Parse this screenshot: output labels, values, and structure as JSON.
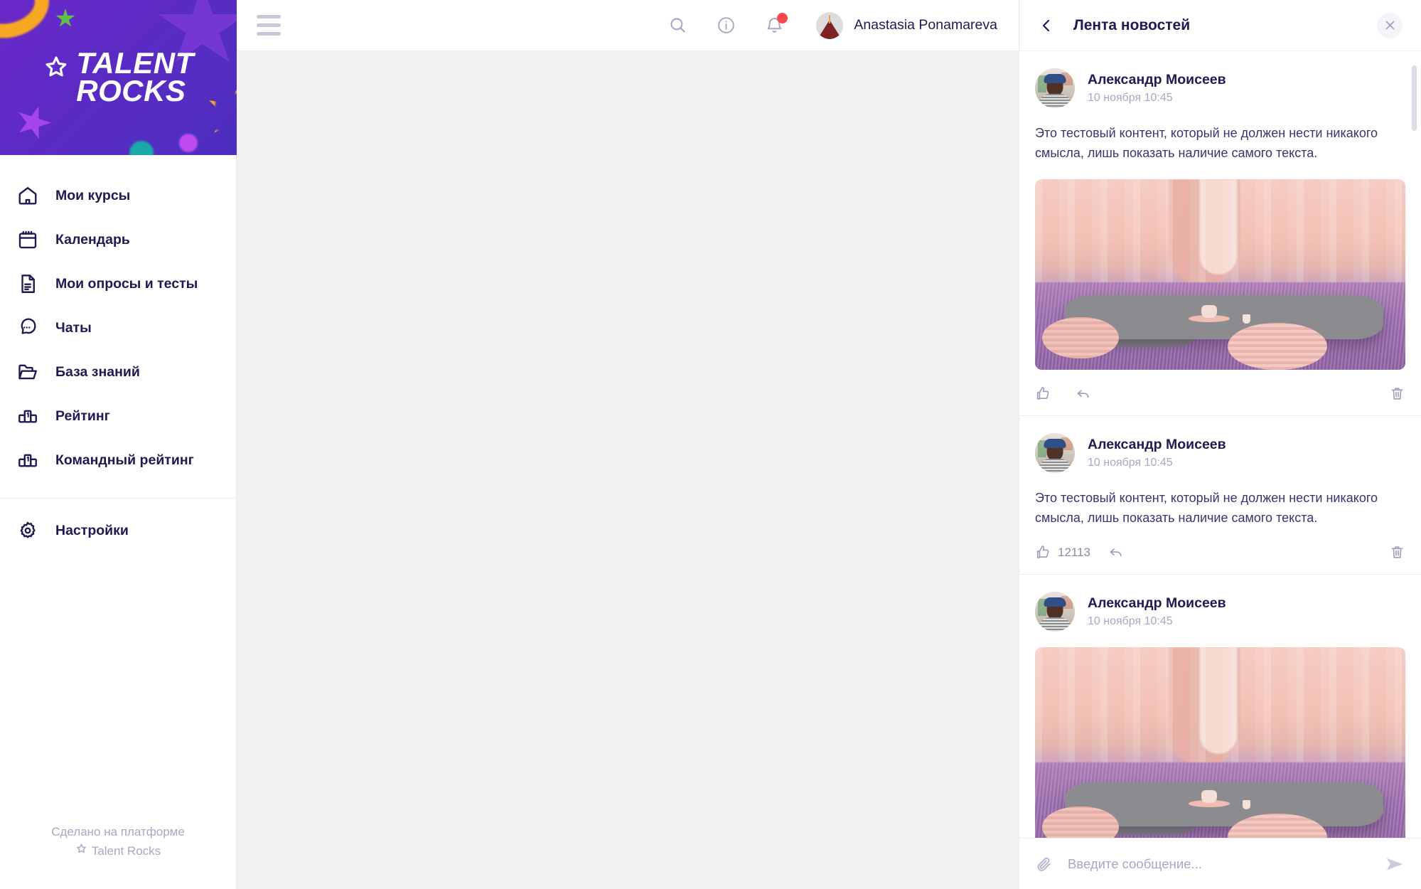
{
  "brand": {
    "line1": "TALENT",
    "line2": "ROCKS",
    "star_icon": "star-icon"
  },
  "sidebar": {
    "items": [
      {
        "label": "Мои курсы",
        "icon": "home-icon"
      },
      {
        "label": "Календарь",
        "icon": "calendar-icon"
      },
      {
        "label": "Мои опросы и тесты",
        "icon": "document-icon"
      },
      {
        "label": "Чаты",
        "icon": "chat-bubble-icon"
      },
      {
        "label": "База знаний",
        "icon": "folder-icon"
      },
      {
        "label": "Рейтинг",
        "icon": "podium-icon"
      },
      {
        "label": "Командный рейтинг",
        "icon": "podium-icon"
      }
    ],
    "settings": {
      "label": "Настройки",
      "icon": "gear-icon"
    },
    "footer": {
      "line1": "Сделано на платформе",
      "line2": "Talent Rocks",
      "star_icon": "star-icon"
    }
  },
  "topbar": {
    "menu_icon": "hamburger-icon",
    "search_icon": "search-icon",
    "info_icon": "info-icon",
    "bell_icon": "bell-icon",
    "has_notification": true,
    "user_name": "Anastasia Ponamareva",
    "avatar_icon": "avatar"
  },
  "panel": {
    "back_icon": "chevron-left-icon",
    "title": "Лента новостей",
    "close_icon": "close-icon",
    "posts": [
      {
        "author": "Александр Моисеев",
        "date": "10 ноября 10:45",
        "text": "Это тестовый контент, который не должен нести никакого смысла, лишь показать наличие самого текста.",
        "has_image": true,
        "like_count": "",
        "like_icon": "thumbs-up-icon",
        "reply_icon": "reply-icon",
        "delete_icon": "trash-icon"
      },
      {
        "author": "Александр Моисеев",
        "date": "10 ноября 10:45",
        "text": "Это тестовый контент, который не должен нести никакого смысла, лишь показать наличие самого текста.",
        "has_image": false,
        "like_count": "12113",
        "like_icon": "thumbs-up-icon",
        "reply_icon": "reply-icon",
        "delete_icon": "trash-icon"
      },
      {
        "author": "Александр Моисеев",
        "date": "10 ноября 10:45",
        "text": "",
        "has_image": true,
        "like_count": "",
        "like_icon": "thumbs-up-icon",
        "reply_icon": "reply-icon",
        "delete_icon": "trash-icon"
      }
    ],
    "composer": {
      "attach_icon": "paperclip-icon",
      "placeholder": "Введите сообщение...",
      "value": "",
      "send_icon": "send-icon"
    }
  },
  "colors": {
    "brand_purple": "#5b2bc4",
    "text_dark": "#1e1a52",
    "text_muted": "#a9a6c4",
    "notification_red": "#f8474f",
    "content_bg": "#f2f2f5"
  }
}
